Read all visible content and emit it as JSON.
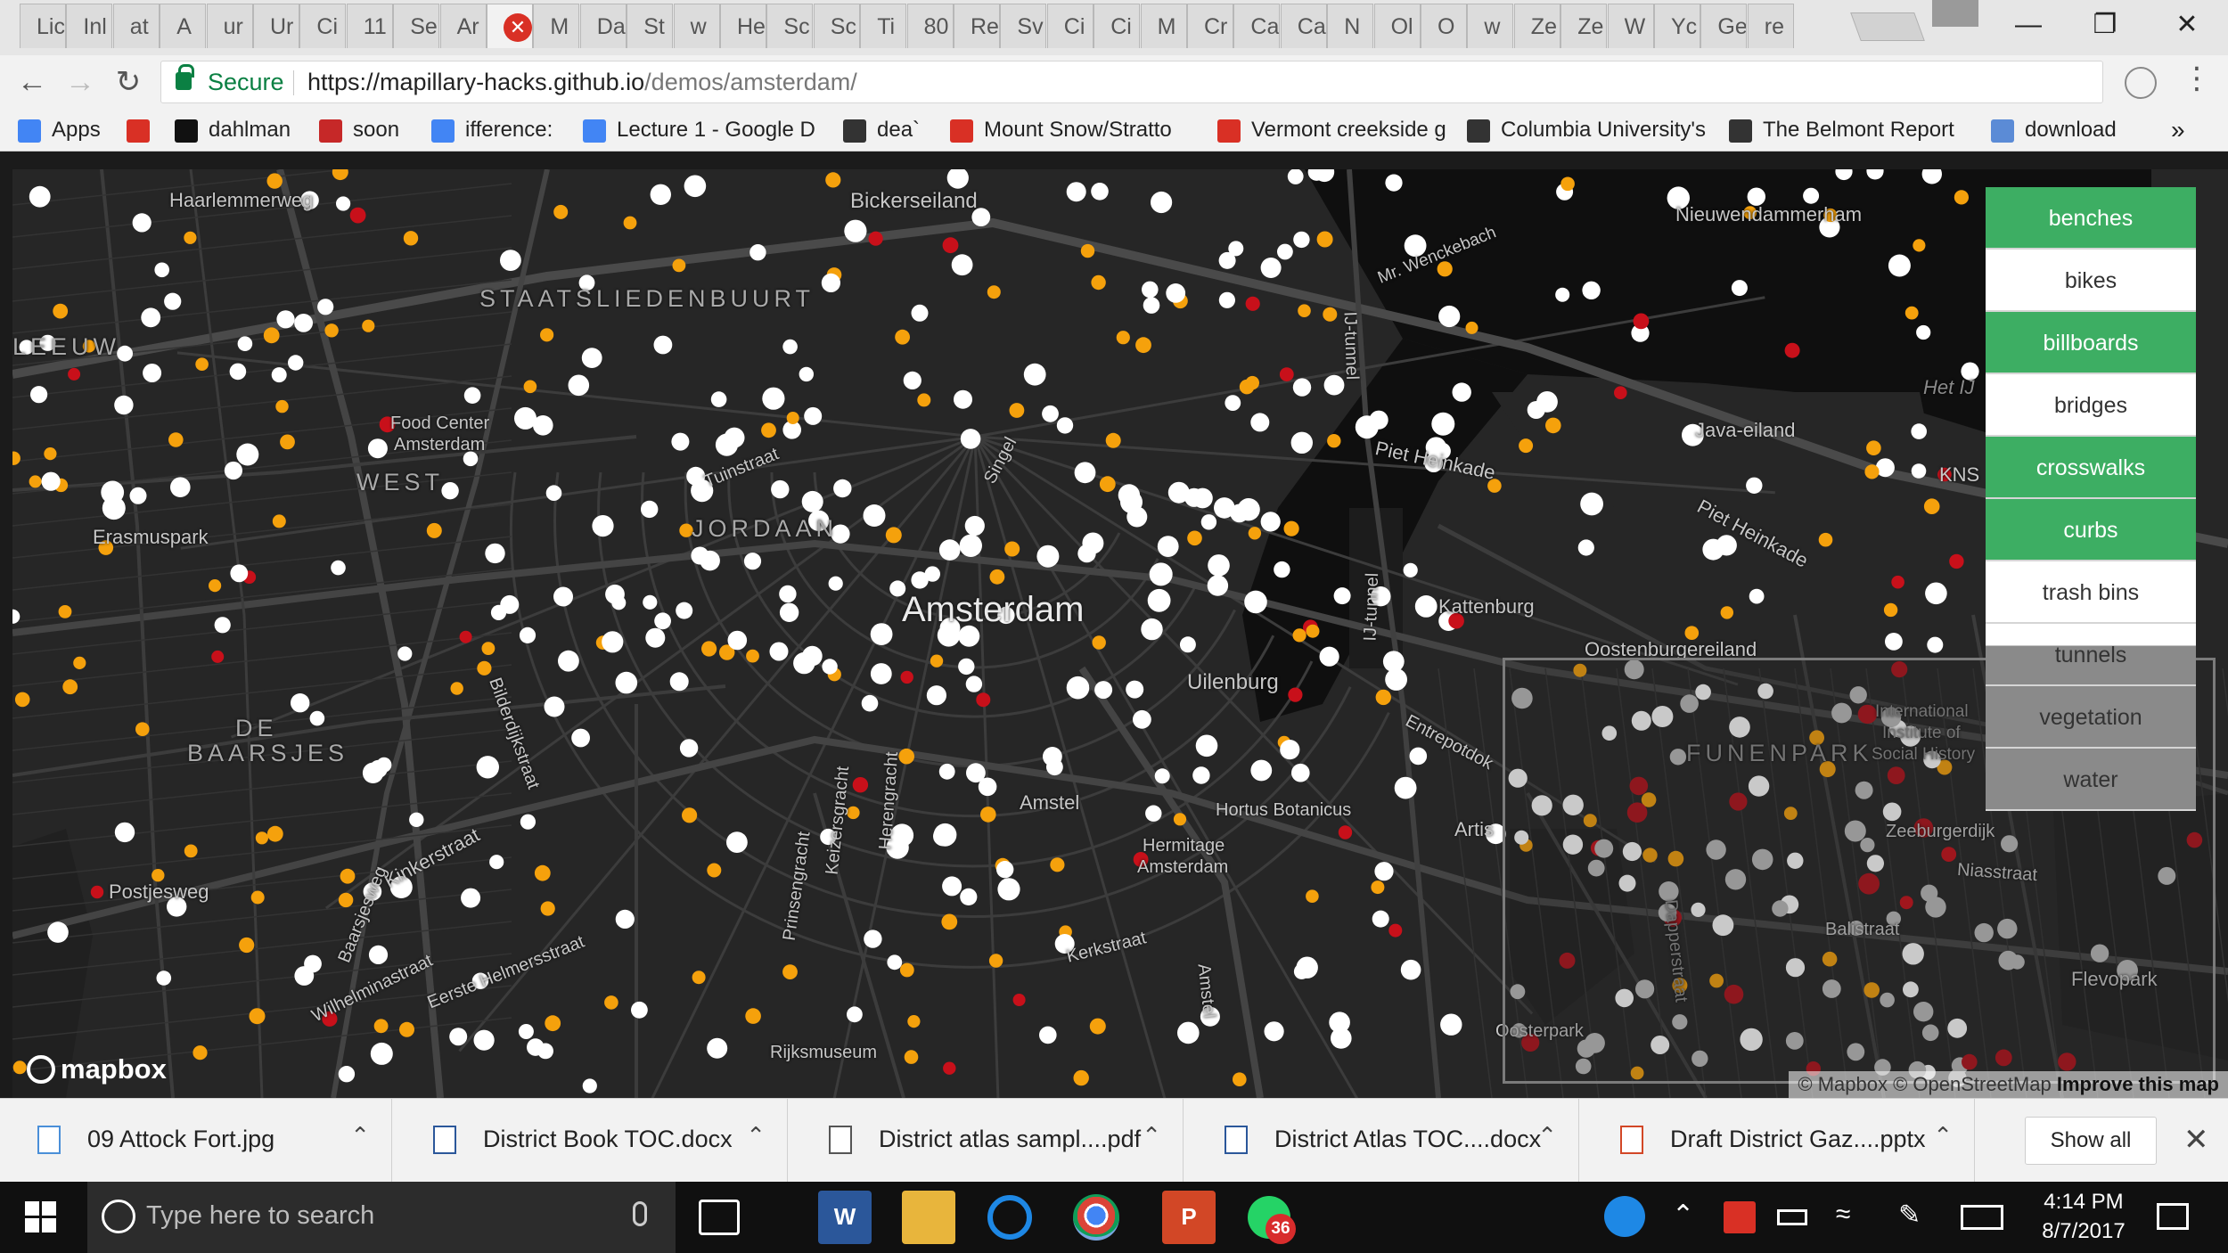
{
  "browser": {
    "tabs": [
      "Lic",
      "Inl",
      "at",
      "A",
      "ur",
      "Ur",
      "Ci",
      "11",
      "Se",
      "Ar",
      "",
      "M",
      "Da",
      "St",
      "w",
      "He",
      "Sc",
      "Sc",
      "Ti",
      "80",
      "Re",
      "Sv",
      "Ci",
      "Ci",
      "M",
      "Cr",
      "Ca",
      "Ca",
      "N",
      "Ol",
      "O",
      "w",
      "Ze",
      "Ze",
      "W",
      "Yc",
      "Ge",
      "re"
    ],
    "active_tab_index": 10,
    "secure_label": "Secure",
    "url_host": "https://mapillary-hacks.github.io",
    "url_path": "/demos/amsterdam/",
    "bookmarks": [
      {
        "label": "Apps",
        "icon": "apps-grid-icon",
        "color": "#4285f4"
      },
      {
        "label": "",
        "icon": "gmail-icon",
        "color": "#d93025"
      },
      {
        "label": "dahlman",
        "icon": "ct-icon",
        "color": "#111111"
      },
      {
        "label": "soon",
        "icon": "red-seal-icon",
        "color": "#c62828"
      },
      {
        "label": "ifference:",
        "icon": "docs-icon",
        "color": "#4285f4"
      },
      {
        "label": "Lecture 1 - Google D",
        "icon": "docs-icon",
        "color": "#4285f4"
      },
      {
        "label": "dea`",
        "icon": "crown-icon",
        "color": "#333333"
      },
      {
        "label": "Mount Snow/Stratto",
        "icon": "mountain-icon",
        "color": "#d93025"
      },
      {
        "label": "Vermont creekside g",
        "icon": "mountain-icon",
        "color": "#d93025"
      },
      {
        "label": "Columbia University's",
        "icon": "crest-icon",
        "color": "#333333"
      },
      {
        "label": "The Belmont Report",
        "icon": "eagle-icon",
        "color": "#333333"
      },
      {
        "label": "download",
        "icon": "r-icon",
        "color": "#5b8bd6"
      }
    ],
    "more_bookmarks": "»"
  },
  "map": {
    "labels": {
      "haarlemmerweg": "Haarlemmerweg",
      "bickerseiland": "Bickerseiland",
      "nieuwendammerham": "Nieuwendammerham",
      "staatsliedenbuurt": "STAATSLIEDENBUURT",
      "leeuw": "LEEUW",
      "food_center": "Food Center",
      "food_center2": "Amsterdam",
      "west": "WEST",
      "erasmuspark": "Erasmuspark",
      "jordaan": "JORDAAN",
      "tuinstraat": "Tuinstraat",
      "amsterdam": "Amsterdam",
      "java_eiland": "Java-eiland",
      "het_ij": "Het IJ",
      "kns": "KNS",
      "piet_heinkade": "Piet Heinkade",
      "piet_heinkade2": "Piet Heinkade",
      "kattenburg": "Kattenburg",
      "oostenburgereiland": "Oostenburgereiland",
      "uilenburg": "Uilenburg",
      "de_baarsjes": "DE",
      "de_baarsjes2": "BAARSJES",
      "amstel": "Amstel",
      "hortus": "Hortus Botanicus",
      "hermitage": "Hermitage",
      "hermitage2": "Amsterdam",
      "artis": "Artis",
      "entrepotdok": "Entrepotdok",
      "funenpark": "FUNENPARK",
      "international": "International",
      "institute": "Institute of",
      "social_history": "Social History",
      "zeeburgerdijk": "Zeeburgerdijk",
      "niasstraat": "Niasstraat",
      "balistraat": "Balistraat",
      "flevopark": "Flevopark",
      "oosterpark": "Oosterpark",
      "kinkerstraat": "Kinkerstraat",
      "wilhelminastraat": "Wilhelminastraat",
      "eerste_helmers": "Eerste Helmersstraat",
      "rijksmuseum": "Rijksmuseum",
      "kerkstraat": "Kerkstraat",
      "postjesweg": "Postjesweg",
      "wenckebach": "Mr. Wenckebach",
      "prinsengracht": "Prinsengracht",
      "keizersgracht": "Keizersgracht",
      "herengracht": "Herengracht",
      "singel": "Singel",
      "bilderdijkstraat": "Bilderdijkstraat",
      "baarsjesweg": "Baarsjesweg",
      "ij_tunnel": "IJ-tunnel",
      "ij_tunnel2": "IJ-tunnel",
      "amstel2": "Amstel",
      "dapperstraat": "Dapperstraat"
    },
    "logo": "mapbox",
    "attribution": "© Mapbox © OpenStreetMap",
    "improve": "Improve this map",
    "point_colors": {
      "white": "#ffffff",
      "orange": "#f5a10c",
      "red": "#c8101a"
    }
  },
  "layers": [
    {
      "label": "benches",
      "state": "on"
    },
    {
      "label": "bikes",
      "state": "off"
    },
    {
      "label": "billboards",
      "state": "on"
    },
    {
      "label": "bridges",
      "state": "off"
    },
    {
      "label": "crosswalks",
      "state": "on"
    },
    {
      "label": "curbs",
      "state": "on"
    },
    {
      "label": "trash bins",
      "state": "off"
    },
    {
      "label": "tunnels",
      "state": "partial"
    },
    {
      "label": "vegetation",
      "state": "dim"
    },
    {
      "label": "water",
      "state": "dim"
    }
  ],
  "downloads": {
    "items": [
      {
        "name": "09 Attock Fort.jpg",
        "icon": "image-file-icon",
        "color": "#4a8fd8"
      },
      {
        "name": "District Book TOC.docx",
        "icon": "word-file-icon",
        "color": "#2b579a"
      },
      {
        "name": "District atlas sampl....pdf",
        "icon": "pdf-file-icon",
        "color": "#555555"
      },
      {
        "name": "District Atlas TOC....docx",
        "icon": "word-file-icon",
        "color": "#2b579a"
      },
      {
        "name": "Draft District Gaz....pptx",
        "icon": "powerpoint-file-icon",
        "color": "#d24726"
      }
    ],
    "show_all": "Show all"
  },
  "taskbar": {
    "search_placeholder": "Type here to search",
    "whatsapp_badge": "36",
    "time": "4:14 PM",
    "date": "8/7/2017"
  }
}
